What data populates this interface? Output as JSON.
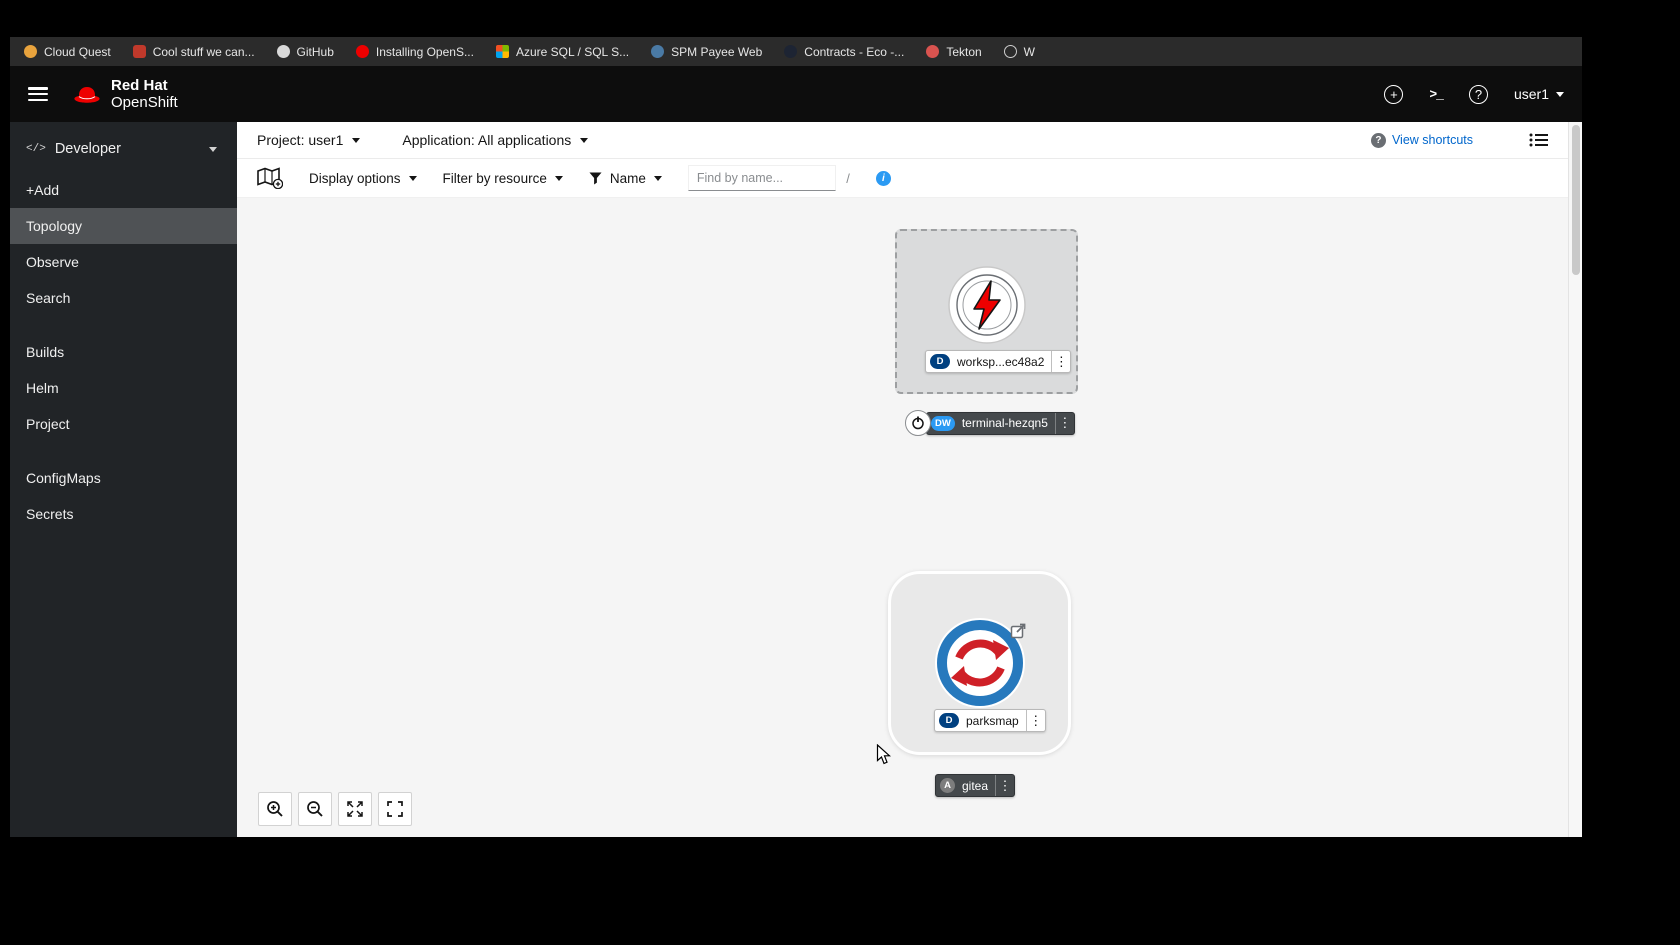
{
  "bookmarks": {
    "items": [
      {
        "label": "Cloud Quest",
        "icon": "cloud-quest-favicon"
      },
      {
        "label": "Cool stuff we can...",
        "icon": "book-favicon"
      },
      {
        "label": "GitHub",
        "icon": "github-favicon"
      },
      {
        "label": "Installing OpenS...",
        "icon": "openshift-favicon"
      },
      {
        "label": "Azure SQL / SQL S...",
        "icon": "microsoft-favicon"
      },
      {
        "label": "SPM Payee Web",
        "icon": "web-favicon"
      },
      {
        "label": "Contracts - Eco -...",
        "icon": "contracts-favicon"
      },
      {
        "label": "Tekton",
        "icon": "tekton-favicon"
      },
      {
        "label": "W",
        "icon": "globe-favicon"
      }
    ]
  },
  "masthead": {
    "brand_top": "Red Hat",
    "brand_bottom": "OpenShift",
    "username": "user1"
  },
  "sidebar": {
    "perspective": "Developer",
    "items": [
      {
        "label": "+Add"
      },
      {
        "label": "Topology",
        "selected": true
      },
      {
        "label": "Observe"
      },
      {
        "label": "Search"
      },
      {
        "label": "Builds"
      },
      {
        "label": "Helm"
      },
      {
        "label": "Project"
      },
      {
        "label": "ConfigMaps"
      },
      {
        "label": "Secrets"
      }
    ]
  },
  "context_bar": {
    "project": "Project: user1",
    "application": "Application: All applications",
    "view_shortcuts": "View shortcuts"
  },
  "toolbar": {
    "display_options": "Display options",
    "filter_by_resource": "Filter by resource",
    "name_filter": "Name",
    "find_placeholder": "Find by name...",
    "shortcut_key": "/"
  },
  "topology": {
    "workspace": {
      "badge": "D",
      "label": "worksp...ec48a2"
    },
    "terminal": {
      "badge": "DW",
      "label": "terminal-hezqn5"
    },
    "parksmap": {
      "badge": "D",
      "label": "parksmap"
    },
    "gitea": {
      "badge": "A",
      "label": "gitea"
    }
  },
  "colors": {
    "brand_red": "#ee0000",
    "link_blue": "#0066cc",
    "badge_deployment": "#004080",
    "badge_devworkspace": "#2b9af3",
    "sidebar_bg": "#212427",
    "selected_nav": "#4f5255",
    "canvas_bg": "#f5f5f5"
  }
}
